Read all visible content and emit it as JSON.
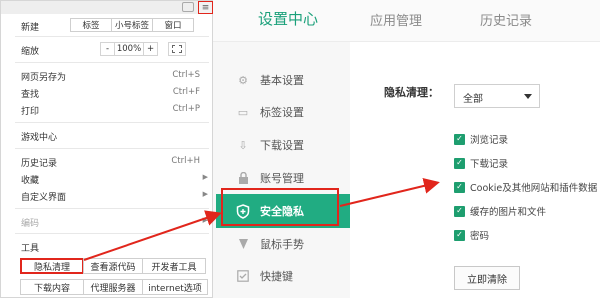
{
  "settings": {
    "tabs": [
      "设置中心",
      "应用管理",
      "历史记录"
    ],
    "nav_items": [
      "基本设置",
      "标签设置",
      "下载设置",
      "账号管理",
      "安全隐私",
      "鼠标手势",
      "快捷键"
    ],
    "privacy_label": "隐私清理：",
    "select_value": "全部",
    "checkboxes": [
      "浏览记录",
      "下载记录",
      "Cookie及其他网站和插件数据",
      "缓存的图片和文件",
      "密码"
    ],
    "clear_button": "立即清除"
  },
  "menu": {
    "new_row": {
      "label": "新建",
      "buttons": [
        "标签",
        "小号标签",
        "窗口"
      ]
    },
    "zoom": {
      "label": "缩放",
      "minus": "-",
      "value": "100%",
      "plus": "+"
    },
    "items": [
      {
        "label": "网页另存为",
        "shortcut": "Ctrl+S"
      },
      {
        "label": "查找",
        "shortcut": "Ctrl+F"
      },
      {
        "label": "打印",
        "shortcut": "Ctrl+P"
      },
      {
        "label": "游戏中心",
        "shortcut": ""
      },
      {
        "label": "历史记录",
        "shortcut": "Ctrl+H"
      },
      {
        "label": "收藏",
        "shortcut": ""
      },
      {
        "label": "自定义界面",
        "shortcut": ""
      },
      {
        "label": "编码",
        "shortcut": ""
      },
      {
        "label": "工具",
        "shortcut": ""
      }
    ],
    "tools_row1": [
      "隐私清理",
      "查看源代码",
      "开发者工具"
    ],
    "tools_row2": [
      "下载内容",
      "代理服务器",
      "internet选项"
    ]
  },
  "colors": {
    "accent": "#21ac82",
    "highlight": "#e1261c"
  },
  "icons": [
    "menu-icon",
    "fullscreen-icon",
    "gear-icon",
    "tab-icon",
    "download-icon",
    "lock-icon",
    "shield-icon",
    "cursor-icon",
    "keyboard-icon",
    "checkmark-icon",
    "dropdown-caret-icon"
  ]
}
